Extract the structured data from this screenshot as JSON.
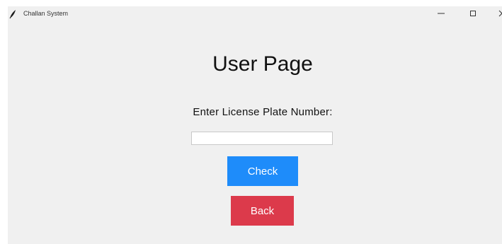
{
  "window": {
    "title": "Challan System",
    "icon": "feather-icon",
    "controls": {
      "minimize": "minimize-icon",
      "maximize": "maximize-icon",
      "close": "close-icon"
    }
  },
  "page": {
    "title": "User Page",
    "prompt_label": "Enter License Plate Number:",
    "plate_input_value": "",
    "check_label": "Check",
    "back_label": "Back"
  },
  "colors": {
    "check_button": "#1e8cfa",
    "back_button": "#dc3a4b",
    "window_background": "#f0f0f0"
  }
}
